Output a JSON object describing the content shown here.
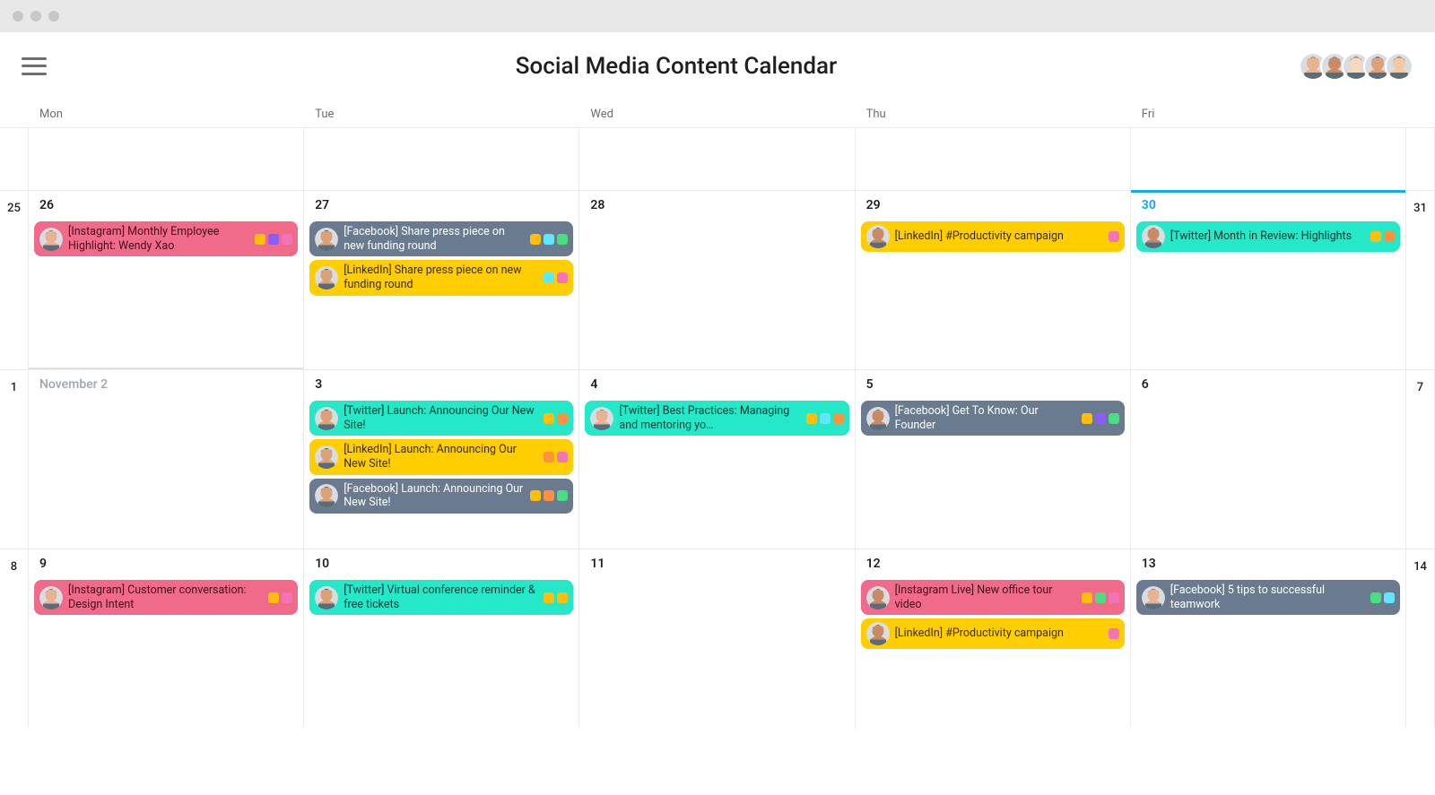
{
  "titlebar": {},
  "header": {
    "title": "Social Media Content Calendar",
    "avatars": [
      "person1",
      "person2",
      "person3",
      "person4",
      "person5"
    ]
  },
  "day_labels": [
    "Mon",
    "Tue",
    "Wed",
    "Thu",
    "Fri"
  ],
  "colors": {
    "pink": "#f06a89",
    "teal": "#25e8c8",
    "slate": "#6a7b8f",
    "yellow": "#ffce00",
    "tag_yellow": "#ffbe0b",
    "tag_purple": "#8b5cf6",
    "tag_pink": "#f472b6",
    "tag_cyan": "#5ee7ff",
    "tag_green": "#4ade80",
    "tag_orange": "#fb923c"
  },
  "weeks": [
    {
      "left": "",
      "right": "",
      "cells": [
        {
          "date": "",
          "events": []
        },
        {
          "date": "",
          "events": []
        },
        {
          "date": "",
          "events": []
        },
        {
          "date": "",
          "events": []
        },
        {
          "date": "",
          "events": []
        }
      ]
    },
    {
      "left": "25",
      "right": "31",
      "cells": [
        {
          "date": "26",
          "month_divider": true,
          "events": [
            {
              "color": "pink",
              "avatar": "p1",
              "text": "[Instagram] Monthly Employ­ee Highlight: Wendy Xao",
              "tags": [
                "tag_yellow",
                "tag_purple",
                "tag_pink"
              ]
            }
          ]
        },
        {
          "date": "27",
          "events": [
            {
              "color": "slate",
              "avatar": "p4",
              "text": "[Facebook] Share press piece on new funding round",
              "tags": [
                "tag_yellow",
                "tag_cyan",
                "tag_green"
              ]
            },
            {
              "color": "yellow",
              "avatar": "p4",
              "text": "[LinkedIn] Share press piece on new funding round",
              "tags": [
                "tag_cyan",
                "tag_pink"
              ]
            }
          ]
        },
        {
          "date": "28",
          "events": []
        },
        {
          "date": "29",
          "events": [
            {
              "color": "yellow",
              "avatar": "p2",
              "text": "[LinkedIn] #Productivity campaign",
              "tags": [
                "tag_pink"
              ]
            }
          ]
        },
        {
          "date": "30",
          "today": true,
          "events": [
            {
              "color": "teal",
              "avatar": "p2",
              "text": "[Twitter] Month in Review: Highlights",
              "tags": [
                "tag_yellow",
                "tag_orange"
              ]
            }
          ]
        }
      ]
    },
    {
      "left": "1",
      "right": "7",
      "cells": [
        {
          "date": "November 2",
          "muted": true,
          "events": []
        },
        {
          "date": "3",
          "events": [
            {
              "color": "teal",
              "avatar": "p4",
              "text": "[Twitter] Launch: Announcing Our New Site!",
              "tags": [
                "tag_yellow",
                "tag_orange"
              ]
            },
            {
              "color": "yellow",
              "avatar": "p4",
              "text": "[LinkedIn] Launch: Announcing Our New Site!",
              "tags": [
                "tag_orange",
                "tag_pink"
              ]
            },
            {
              "color": "slate",
              "avatar": "p4",
              "text": "[Facebook] Launch: An­nouncing Our New Site!",
              "tags": [
                "tag_yellow",
                "tag_orange",
                "tag_green"
              ]
            }
          ]
        },
        {
          "date": "4",
          "events": [
            {
              "color": "teal",
              "avatar": "p1",
              "text": "[Twitter] Best Practices: Managing and mentoring yo…",
              "tags": [
                "tag_yellow",
                "tag_cyan",
                "tag_orange"
              ]
            }
          ]
        },
        {
          "date": "5",
          "events": [
            {
              "color": "slate",
              "avatar": "p2",
              "text": "[Facebook] Get To Know: Our Founder",
              "tags": [
                "tag_yellow",
                "tag_purple",
                "tag_green"
              ]
            }
          ]
        },
        {
          "date": "6",
          "events": []
        }
      ]
    },
    {
      "left": "8",
      "right": "14",
      "cells": [
        {
          "date": "9",
          "events": [
            {
              "color": "pink",
              "avatar": "p1",
              "text": "[Instagram] Customer conver­sation: Design Intent",
              "tags": [
                "tag_yellow",
                "tag_pink"
              ]
            }
          ]
        },
        {
          "date": "10",
          "events": [
            {
              "color": "teal",
              "avatar": "p4",
              "text": "[Twitter] Virtual conference re­minder & free tickets",
              "tags": [
                "tag_yellow",
                "tag_yellow"
              ]
            }
          ]
        },
        {
          "date": "11",
          "events": []
        },
        {
          "date": "12",
          "events": [
            {
              "color": "pink",
              "avatar": "p2",
              "text": "[Instagram Live] New office tour video",
              "tags": [
                "tag_yellow",
                "tag_green",
                "tag_pink"
              ]
            },
            {
              "color": "yellow",
              "avatar": "p2",
              "text": "[LinkedIn] #Productivity campaign",
              "tags": [
                "tag_pink"
              ]
            }
          ]
        },
        {
          "date": "13",
          "events": [
            {
              "color": "slate",
              "avatar": "p1",
              "text": "[Facebook] 5 tips to successful teamwork",
              "tags": [
                "tag_green",
                "tag_cyan"
              ]
            }
          ]
        }
      ]
    }
  ]
}
